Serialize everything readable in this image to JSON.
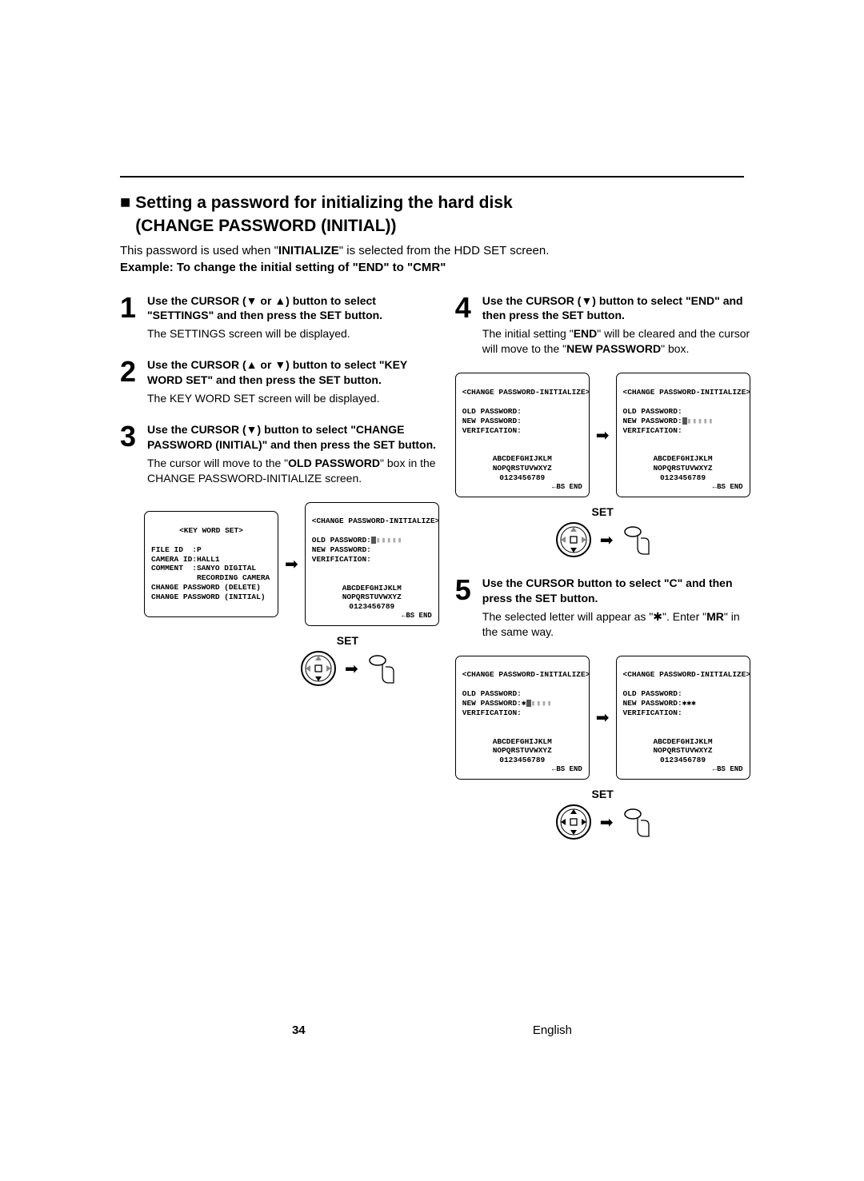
{
  "section": {
    "prefix_icon": "■",
    "title_line1": "Setting a password for initializing the hard disk",
    "title_line2": "(CHANGE PASSWORD (INITIAL))",
    "intro_pre": "This password is used when \"",
    "intro_bold": "INITIALIZE",
    "intro_post": "\" is selected from the HDD SET screen.",
    "example": "Example:  To change the initial setting of \"END\" to \"CMR\""
  },
  "steps": {
    "s1": {
      "num": "1",
      "head": "Use the CURSOR (▼ or ▲) button to select \"SETTINGS\" and then press the SET button.",
      "body": "The SETTINGS screen will be displayed."
    },
    "s2": {
      "num": "2",
      "head": "Use the CURSOR (▲ or ▼) button to select \"KEY WORD SET\" and then press the SET button.",
      "body": "The KEY WORD SET screen will be displayed."
    },
    "s3": {
      "num": "3",
      "head": "Use the CURSOR (▼) button to select \"CHANGE PASSWORD (INITIAL)\" and then press the SET button.",
      "body_pre": "The cursor will move to the \"",
      "body_bold1": "OLD PASSWORD",
      "body_post": "\" box in the CHANGE PASSWORD-INITIALIZE screen."
    },
    "s4": {
      "num": "4",
      "head": "Use the CURSOR (▼) button to select \"END\" and then press the SET button.",
      "body_pre": "The initial setting \"",
      "body_bold1": "END",
      "body_mid": "\" will be cleared and the cursor will move to the \"",
      "body_bold2": "NEW PASSWORD",
      "body_post": "\" box."
    },
    "s5": {
      "num": "5",
      "head": "Use the CURSOR button to select \"C\" and then press the SET button.",
      "body_pre": "The selected letter will appear as \"✱\". Enter \"",
      "body_bold1": "MR",
      "body_post": "\" in the same way."
    }
  },
  "osd": {
    "keyword": {
      "title": "<KEY WORD SET>",
      "l1": "FILE ID  :P",
      "l2": "CAMERA ID:HALL1",
      "l3": "COMMENT  :SANYO DIGITAL",
      "l4": "          RECORDING CAMERA",
      "l5": "CHANGE PASSWORD (DELETE)",
      "l6": "CHANGE PASSWORD (INITIAL)"
    },
    "cp_title": "<CHANGE PASSWORD-INITIALIZE>",
    "old_pw": "OLD PASSWORD:",
    "new_pw": "NEW PASSWORD:",
    "verif": "VERIFICATION:",
    "alpha1": "ABCDEFGHIJKLM",
    "alpha2": "NOPQRSTUVWXYZ",
    "nums": "0123456789",
    "bs_end": "←BS END",
    "set": "SET",
    "dim5": "▮▮▮▮▮",
    "dim4": "▮▮▮▮",
    "ast1": "✱",
    "ast3": "✱✱✱"
  },
  "footer": {
    "page": "34",
    "lang": "English"
  }
}
